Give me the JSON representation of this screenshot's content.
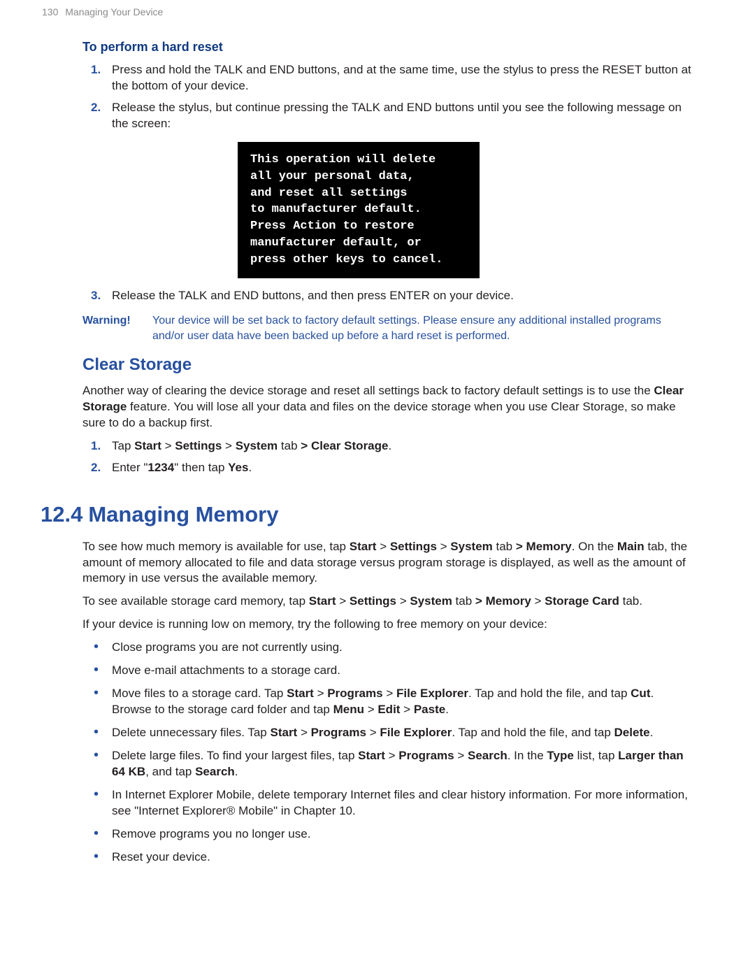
{
  "running": {
    "page_number": "130",
    "title": "Managing Your Device"
  },
  "hard_reset": {
    "heading": "To perform a hard reset",
    "steps": {
      "s1": {
        "num": "1.",
        "text": "Press and hold the TALK and END buttons, and at the same time, use the stylus to press the RESET button at the bottom of your device."
      },
      "s2": {
        "num": "2.",
        "text": "Release the stylus, but continue pressing the TALK and END buttons until you see the following message on the screen:"
      },
      "s3": {
        "num": "3.",
        "text": "Release the TALK and END buttons, and then press ENTER on your device."
      }
    },
    "screen_message": "This operation will delete\nall your personal data,\nand reset all settings\nto manufacturer default.\nPress Action to restore\nmanufacturer default, or\npress other keys to cancel.",
    "warning_label": "Warning!",
    "warning_text": "Your device will be set back to factory default settings. Please ensure any additional installed programs and/or user data have been backed up before a hard reset is performed."
  },
  "clear_storage": {
    "heading": "Clear Storage",
    "intro_pre": "Another way of clearing the device storage and reset all settings back to factory default settings is to use the ",
    "intro_bold": "Clear Storage",
    "intro_post": " feature. You will lose all your data and files on the device storage when you use Clear Storage, so make sure to do a backup first.",
    "steps": {
      "s1": {
        "num": "1.",
        "t1": "Tap ",
        "b1": "Start",
        "t2": " > ",
        "b2": "Settings",
        "t3": " > ",
        "b3": "System",
        "t4": " tab ",
        "b4": ">",
        "t5": " ",
        "b5": "Clear Storage",
        "t6": "."
      },
      "s2": {
        "num": "2.",
        "t1": "Enter \"",
        "b1": "1234",
        "t2": "\" then tap ",
        "b2": "Yes",
        "t3": "."
      }
    }
  },
  "memory": {
    "secnum": "12.4",
    "heading": "Managing Memory",
    "p1": {
      "t1": "To see how much memory is available for use, tap ",
      "b1": "Start",
      "t2": " > ",
      "b2": "Settings",
      "t3": " > ",
      "b3": "System",
      "t4": " tab ",
      "b4": ">",
      "t5": " ",
      "b5": "Memory",
      "t6": ". On the ",
      "b6": "Main",
      "t7": " tab, the amount of memory allocated to file and data storage versus program storage is displayed, as well as the amount of memory in use versus the available memory."
    },
    "p2": {
      "t1": "To see available storage card memory, tap ",
      "b1": "Start",
      "t2": " > ",
      "b2": "Settings",
      "t3": " > ",
      "b3": "System",
      "t4": " tab ",
      "b4": ">",
      "t5": " ",
      "b5": "Memory",
      "t6": " > ",
      "b6": "Storage Card",
      "t7": " tab."
    },
    "p3": "If your device is running low on memory, try the following to free memory on your device:",
    "bullets": {
      "li1": "Close programs you are not currently using.",
      "li2": "Move e-mail attachments to a storage card.",
      "li3": {
        "t1": "Move files to a storage card. Tap ",
        "b1": "Start",
        "t2": " > ",
        "b2": "Programs",
        "t3": " > ",
        "b3": "File Explorer",
        "t4": ". Tap and hold the file, and tap ",
        "b4": "Cut",
        "t5": ". Browse to the storage card folder and tap ",
        "b5": "Menu",
        "t6": " > ",
        "b6": "Edit",
        "t7": " > ",
        "b7": "Paste",
        "t8": "."
      },
      "li4": {
        "t1": "Delete unnecessary files. Tap ",
        "b1": "Start",
        "t2": " > ",
        "b2": "Programs",
        "t3": " > ",
        "b3": "File Explorer",
        "t4": ". Tap and hold the file, and tap ",
        "b4": "Delete",
        "t5": "."
      },
      "li5": {
        "t1": "Delete large files. To find your largest files, tap ",
        "b1": "Start",
        "t2": " > ",
        "b2": "Programs",
        "t3": " > ",
        "b3": "Search",
        "t4": ". In the ",
        "b4": "Type",
        "t5": " list, tap ",
        "b5": "Larger than 64 KB",
        "t6": ", and tap ",
        "b6": "Search",
        "t7": "."
      },
      "li6": "In Internet Explorer Mobile, delete temporary Internet files and clear history information. For more information, see \"Internet Explorer® Mobile\" in Chapter 10.",
      "li7": "Remove programs you no longer use.",
      "li8": "Reset your device."
    }
  }
}
